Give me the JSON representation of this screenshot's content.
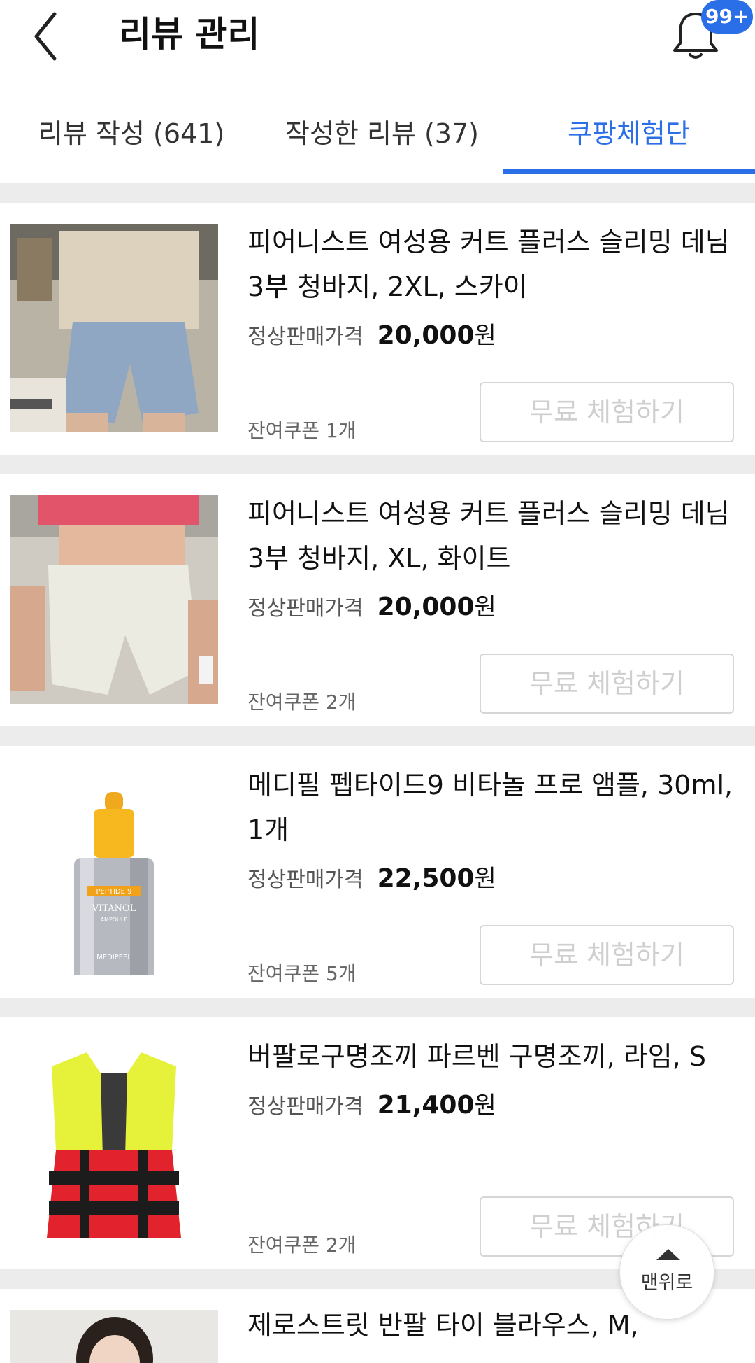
{
  "header": {
    "title": "리뷰 관리",
    "notification_badge": "99+"
  },
  "tabs": [
    {
      "label": "리뷰 작성 (641)",
      "active": false
    },
    {
      "label": "작성한 리뷰 (37)",
      "active": false
    },
    {
      "label": "쿠팡체험단",
      "active": true
    }
  ],
  "colors": {
    "accent": "#2b6fe8",
    "divider": "#ececec"
  },
  "items": [
    {
      "name": "피어니스트 여성용 커트 플러스 슬리밍 데님 3부 청바지, 2XL, 스카이",
      "price_label": "정상판매가격",
      "price": "20,000",
      "currency": "원",
      "coupon": "잔여쿠폰 1개",
      "button": "무료 체험하기",
      "image": "denim-shorts-blue"
    },
    {
      "name": "피어니스트 여성용 커트 플러스 슬리밍 데님 3부 청바지, XL, 화이트",
      "price_label": "정상판매가격",
      "price": "20,000",
      "currency": "원",
      "coupon": "잔여쿠폰 2개",
      "button": "무료 체험하기",
      "image": "denim-shorts-white"
    },
    {
      "name": "메디필 펩타이드9 비타놀 프로 앰플, 30ml, 1개",
      "price_label": "정상판매가격",
      "price": "22,500",
      "currency": "원",
      "coupon": "잔여쿠폰 5개",
      "button": "무료 체험하기",
      "image": "ampoule-bottle",
      "bottle_text": [
        "PEPTIDE 9",
        "VITANOL",
        "AMPOULE",
        "MEDIPEEL"
      ]
    },
    {
      "name": "버팔로구명조끼 파르벤 구명조끼, 라임, S",
      "price_label": "정상판매가격",
      "price": "21,400",
      "currency": "원",
      "coupon": "잔여쿠폰 2개",
      "button": "무료 체험하기",
      "image": "life-vest-lime"
    },
    {
      "name": "제로스트릿 반팔 타이 블라우스, M,",
      "image": "blouse-model"
    }
  ],
  "scroll_top": {
    "label": "맨위로"
  }
}
